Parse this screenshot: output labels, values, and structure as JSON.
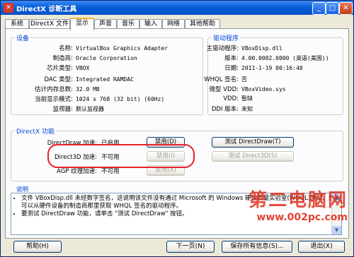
{
  "window": {
    "title": "DirectX 诊断工具"
  },
  "tabs": [
    "系统",
    "DirectX 文件",
    "显示",
    "声音",
    "音乐",
    "输入",
    "网络",
    "其他帮助"
  ],
  "device": {
    "title": "设备",
    "rows": [
      {
        "k": "名称:",
        "v": "VirtualBox Graphics Adapter"
      },
      {
        "k": "制造商:",
        "v": "Oracle Corporation"
      },
      {
        "k": "芯片类型:",
        "v": "VBOX"
      },
      {
        "k": "DAC 类型:",
        "v": "Integrated RAMDAC"
      },
      {
        "k": "估计内存总数:",
        "v": "32.0 MB"
      },
      {
        "k": "当前显示模式:",
        "v": "1024 x 768 (32 bit) (60Hz)"
      },
      {
        "k": "监视器:",
        "v": "默认监视器"
      }
    ]
  },
  "driver": {
    "title": "驱动程序",
    "rows": [
      {
        "k": "主驱动程序:",
        "v": "VBoxDisp.dll"
      },
      {
        "k": "版本:",
        "v": "4.00.0002.0000 (英语(美国))"
      },
      {
        "k": "日期:",
        "v": "2011-1-19 00:16:48"
      },
      {
        "k": "WHQL 签名:",
        "v": "否"
      },
      {
        "k": "微型 VDD:",
        "v": "VBoxVideo.sys"
      },
      {
        "k": "VDD:",
        "v": "暂缺"
      },
      {
        "k": "DDI 版本:",
        "v": "未知"
      }
    ]
  },
  "features": {
    "title": "DirectX 功能",
    "rows": [
      {
        "label": "DirectDraw 加速:",
        "value": "已启用",
        "btn": "禁用(D)",
        "disabled": false
      },
      {
        "label": "Direct3D 加速:",
        "value": "不可用",
        "btn": "禁用(I)",
        "disabled": true
      },
      {
        "label": "AGP 纹理加速:",
        "value": "不可用",
        "btn": "禁用(X)",
        "disabled": true
      }
    ],
    "test_directdraw": "测试 DirectDraw(T)",
    "test_direct3d": "测试 Direct3D(S)"
  },
  "notes": {
    "title": "说明",
    "items": [
      "文件 VBoxDisp.dll 未经数字签名，这说明该文件没有通过 Microsoft 的 Windows 硬件质量实验室(WHQL)测试。您",
      "可以从硬件设备的制造商那里获取 WHQL 签名的驱动程序。",
      "要测试 DirectDraw 功能，请单击 \"测试 DirectDraw\" 按钮。"
    ]
  },
  "buttons": {
    "help": "帮助(H)",
    "next": "下一页(N)",
    "save": "保存所有信息(S)...",
    "exit": "退出(X)"
  },
  "watermark": {
    "big": "第二电脑网",
    "url": "www.002pc.com"
  }
}
